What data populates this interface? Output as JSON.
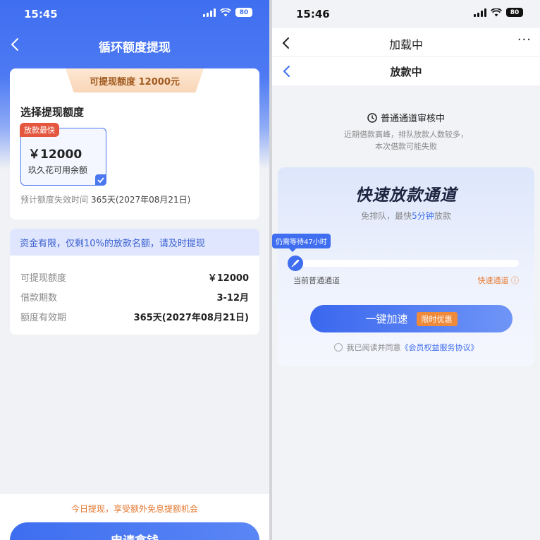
{
  "left": {
    "status": {
      "time": "15:45",
      "battery": "80"
    },
    "nav": {
      "title": "循环额度提现"
    },
    "card": {
      "limit_banner": "可提现额度 12000元",
      "select_title": "选择提现额度",
      "option": {
        "tag": "放款最快",
        "amount": "￥12000",
        "desc": "玖久花可用余额"
      },
      "expiry_label": "预计额度失效时间",
      "expiry_value": "365天(2027年08月21日)"
    },
    "notice": "资金有限，仅剩10%的放款名额，请及时提现",
    "details": [
      {
        "label": "可提现额度",
        "value": "￥12000"
      },
      {
        "label": "借款期数",
        "value": "3-12月"
      },
      {
        "label": "额度有效期",
        "value": "365天(2027年08月21日)"
      }
    ],
    "promo": "今日提现，享受额外免息提额机会",
    "apply_button": "申请拿钱"
  },
  "right": {
    "status": {
      "time": "15:46",
      "battery": "80"
    },
    "nav1": {
      "title": "加载中",
      "more": "···"
    },
    "nav2": {
      "title": "放款中"
    },
    "review": {
      "status": "普通通道审核中",
      "desc1": "近期借款高峰，排队放款人数较多，",
      "desc2": "本次借款可能失败"
    },
    "fast": {
      "title": "快速放款通道",
      "sub_prefix": "免排队，最快",
      "sub_highlight": "5分钟",
      "sub_suffix": "放款",
      "tooltip": "仍需等待47小时",
      "left_label": "当前普通通道",
      "right_label": "快速通道 ⓘ",
      "button_label": "一键加速",
      "button_badge": "限时优惠",
      "agree_prefix": "我已阅读并同意",
      "agree_link": "《会员权益服务协议》"
    }
  },
  "colors": {
    "brand_blue": "#3f6ef0",
    "accent_orange": "#e67a30",
    "tag_red": "#e4573e"
  },
  "icons": [
    "back-icon",
    "signal-icon",
    "wifi-icon",
    "battery-icon",
    "check-icon",
    "clock-icon",
    "rocket-icon",
    "more-icon",
    "radio-icon"
  ]
}
